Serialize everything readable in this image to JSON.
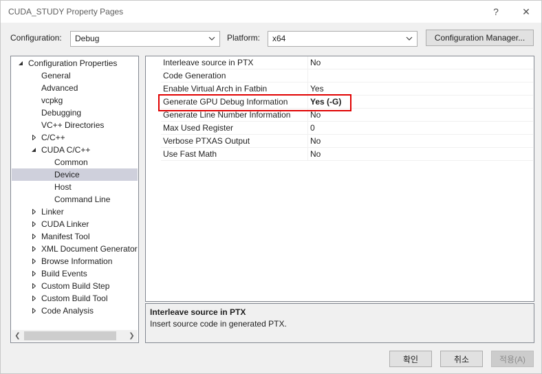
{
  "window": {
    "title": "CUDA_STUDY Property Pages",
    "help_glyph": "?",
    "close_glyph": "✕"
  },
  "toolbar": {
    "configuration_label": "Configuration:",
    "configuration_value": "Debug",
    "platform_label": "Platform:",
    "platform_value": "x64",
    "config_manager_label": "Configuration Manager..."
  },
  "tree": {
    "items": [
      {
        "label": "Configuration Properties",
        "arrow": "expanded"
      },
      {
        "label": "General"
      },
      {
        "label": "Advanced"
      },
      {
        "label": "vcpkg"
      },
      {
        "label": "Debugging"
      },
      {
        "label": "VC++ Directories"
      },
      {
        "label": "C/C++",
        "arrow": "collapsed"
      },
      {
        "label": "CUDA C/C++",
        "arrow": "expanded"
      },
      {
        "label": "Common"
      },
      {
        "label": "Device",
        "selected": true
      },
      {
        "label": "Host"
      },
      {
        "label": "Command Line"
      },
      {
        "label": "Linker",
        "arrow": "collapsed"
      },
      {
        "label": "CUDA Linker",
        "arrow": "collapsed"
      },
      {
        "label": "Manifest Tool",
        "arrow": "collapsed"
      },
      {
        "label": "XML Document Generator",
        "arrow": "collapsed"
      },
      {
        "label": "Browse Information",
        "arrow": "collapsed"
      },
      {
        "label": "Build Events",
        "arrow": "collapsed"
      },
      {
        "label": "Custom Build Step",
        "arrow": "collapsed"
      },
      {
        "label": "Custom Build Tool",
        "arrow": "collapsed"
      },
      {
        "label": "Code Analysis",
        "arrow": "collapsed"
      }
    ]
  },
  "grid": {
    "rows": [
      {
        "name": "Interleave source in PTX",
        "value": "No"
      },
      {
        "name": "Code Generation",
        "value": ""
      },
      {
        "name": "Enable Virtual Arch in Fatbin",
        "value": "Yes"
      },
      {
        "name": "Generate GPU Debug Information",
        "value": "Yes (-G)",
        "bold": true
      },
      {
        "name": "Generate Line Number Information",
        "value": "No"
      },
      {
        "name": "Max Used Register",
        "value": "0"
      },
      {
        "name": "Verbose PTXAS Output",
        "value": "No"
      },
      {
        "name": "Use Fast Math",
        "value": "No"
      }
    ]
  },
  "description": {
    "title": "Interleave source in PTX",
    "text": "Insert source code in generated PTX."
  },
  "buttons": {
    "ok": "확인",
    "cancel": "취소",
    "apply": "적용(A)"
  },
  "colors": {
    "highlight": "#e00000",
    "selected_bg": "#cfd0dc"
  }
}
